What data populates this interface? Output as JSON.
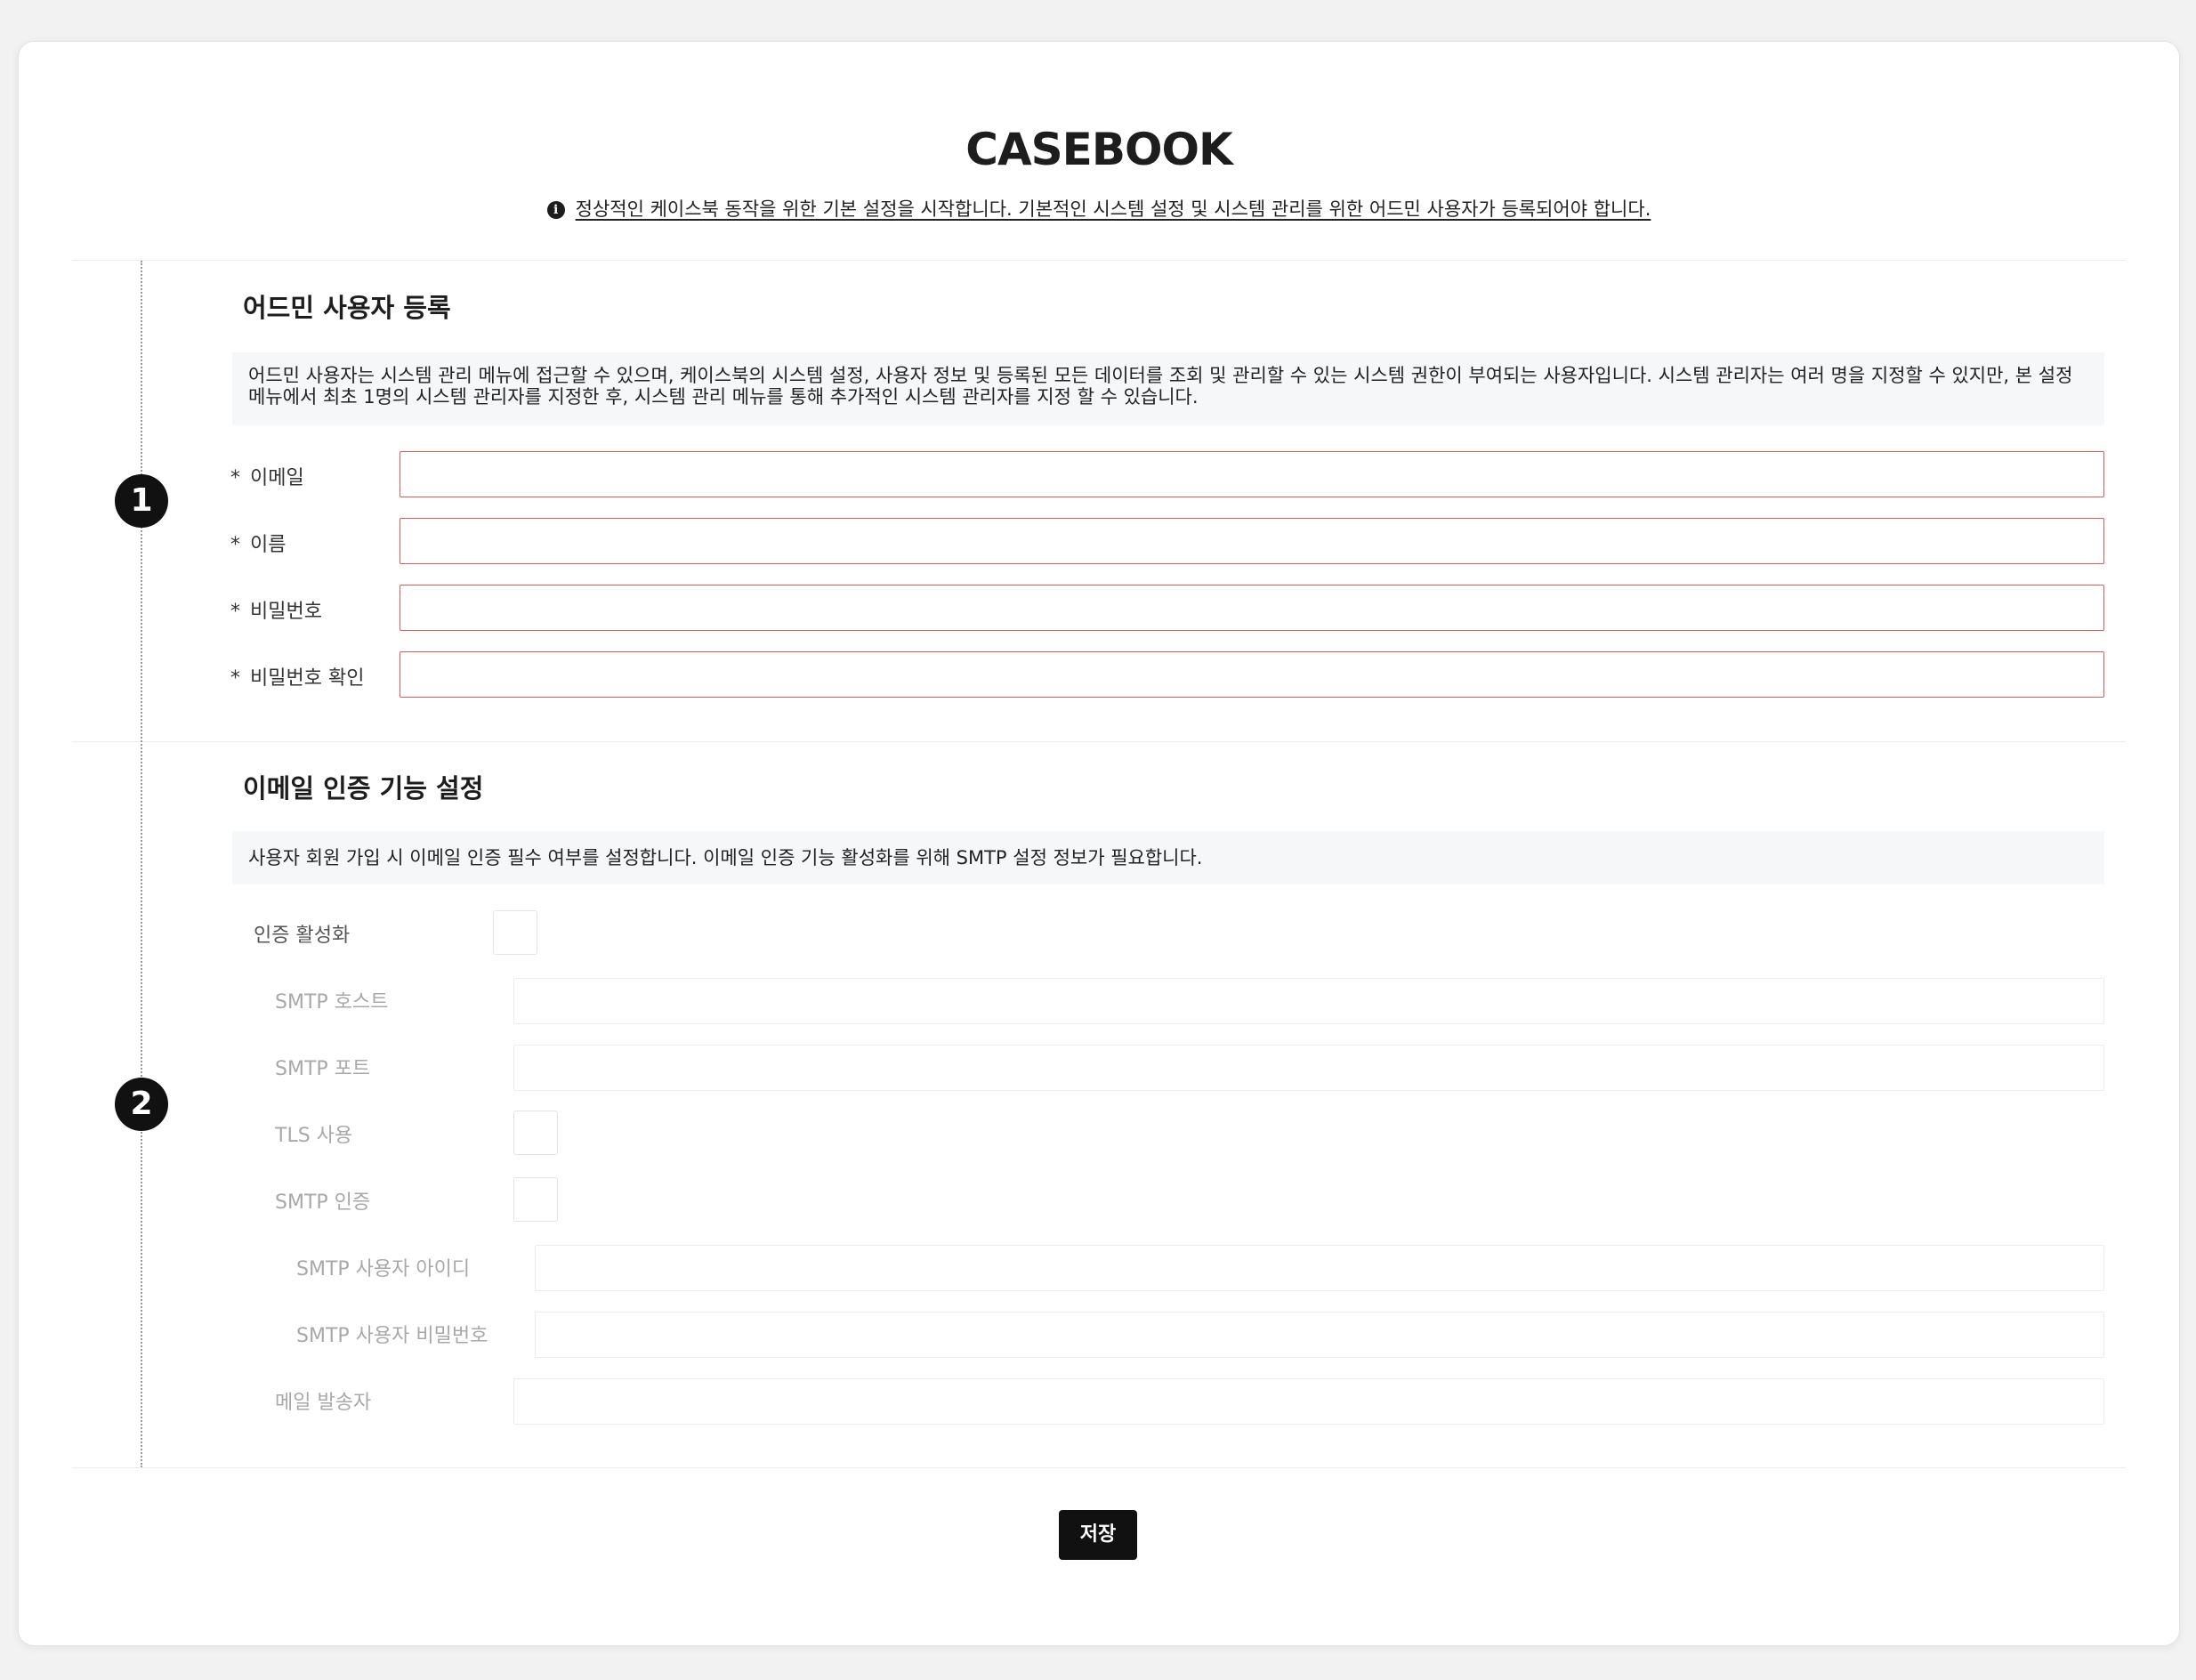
{
  "brand": {
    "logo_text": "CASEBOOK"
  },
  "notice": {
    "icon": "info-icon",
    "text": "정상적인 케이스북 동작을 위한 기본 설정을 시작합니다. 기본적인 시스템 설정 및 시스템 관리를 위한 어드민 사용자가 등록되어야 합니다."
  },
  "admin_section": {
    "step": "1",
    "title": "어드민 사용자 등록",
    "description": "어드민 사용자는 시스템 관리 메뉴에 접근할 수 있으며, 케이스북의 시스템 설정, 사용자 정보 및 등록된 모든 데이터를 조회 및 관리할 수 있는 시스템 권한이 부여되는 사용자입니다. 시스템 관리자는 여러 명을 지정할 수 있지만, 본 설정 메뉴에서 최초 1명의 시스템 관리자를 지정한 후, 시스템 관리 메뉴를 통해 추가적인 시스템 관리자를 지정 할 수 있습니다.",
    "required_mark": "*",
    "fields": [
      {
        "label": "이메일",
        "value": ""
      },
      {
        "label": "이름",
        "value": ""
      },
      {
        "label": "비밀번호",
        "value": ""
      },
      {
        "label": "비밀번호 확인",
        "value": ""
      }
    ]
  },
  "email_section": {
    "step": "2",
    "title": "이메일 인증 기능 설정",
    "description": "사용자 회원 가입 시 이메일 인증 필수 여부를 설정합니다. 이메일 인증 기능 활성화를 위해 SMTP 설정 정보가 필요합니다.",
    "enable_label": "인증 활성화",
    "enable_checked": false,
    "smtp_host_label": "SMTP 호스트",
    "smtp_host_value": "",
    "smtp_port_label": "SMTP 포트",
    "smtp_port_value": "",
    "tls_label": "TLS 사용",
    "tls_checked": false,
    "smtp_auth_label": "SMTP 인증",
    "smtp_auth_checked": false,
    "smtp_user_label": "SMTP 사용자 아이디",
    "smtp_user_value": "",
    "smtp_password_label": "SMTP 사용자 비밀번호",
    "smtp_password_value": "",
    "sender_label": "메일 발송자",
    "sender_value": ""
  },
  "actions": {
    "save_label": "저장"
  },
  "colors": {
    "required_border": "#e05a5a",
    "primary_button": "#111111"
  }
}
